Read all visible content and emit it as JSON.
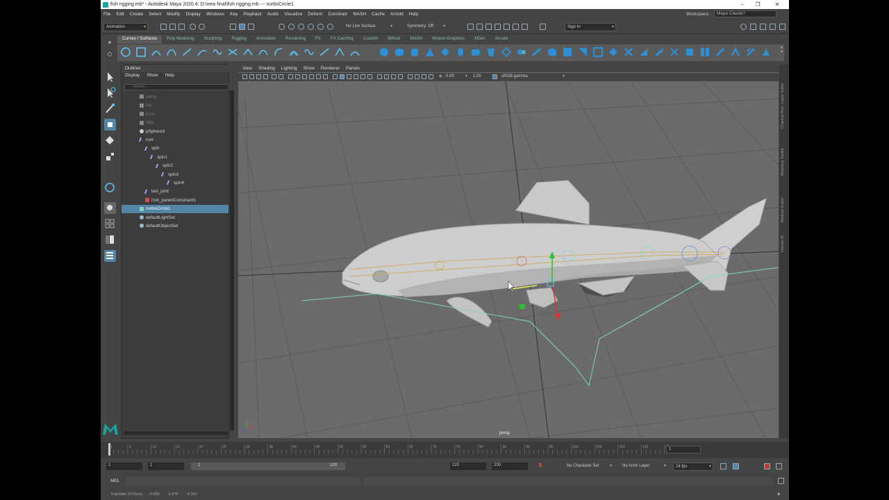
{
  "window": {
    "title": "fish rigging.mb* - Autodesk Maya 2020.4: D:\\new final\\fish rigging.mb  ---  nurbsCircle1",
    "controls": [
      "–",
      "❐",
      "✕"
    ]
  },
  "menubar": {
    "items": [
      "File",
      "Edit",
      "Create",
      "Select",
      "Modify",
      "Display",
      "Windows",
      "Key",
      "Playback",
      "Audio",
      "Visualize",
      "Deform",
      "Constrain",
      "MASH",
      "Cache",
      "Arnold",
      "Help"
    ]
  },
  "workspace": {
    "label": "Workspace :",
    "value": "Maya Classic*"
  },
  "statusline": {
    "menuset": "Animation",
    "live_surface": "No Live Surface",
    "symmetry": "Symmetry: Off",
    "signin": "Sign In"
  },
  "shelf": {
    "tabs": [
      "Curves / Surfaces",
      "Poly Modeling",
      "Sculpting",
      "Rigging",
      "Animation",
      "Rendering",
      "FX",
      "FX Caching",
      "Custom",
      "Bifrost",
      "MASH",
      "Motion Graphics",
      "XGen",
      "Arnold"
    ],
    "active_tab": "Curves / Surfaces"
  },
  "outliner": {
    "title": "Outliner",
    "menu": [
      "Display",
      "Show",
      "Help"
    ],
    "search_placeholder": "Search...",
    "items": [
      {
        "label": "persp",
        "indent": 0,
        "type": "camera",
        "dim": true
      },
      {
        "label": "top",
        "indent": 0,
        "type": "camera",
        "dim": true
      },
      {
        "label": "front",
        "indent": 0,
        "type": "camera",
        "dim": true
      },
      {
        "label": "side",
        "indent": 0,
        "type": "camera",
        "dim": true
      },
      {
        "label": "pSphere3",
        "indent": 0,
        "type": "mesh",
        "dim": false
      },
      {
        "label": "root",
        "indent": 0,
        "type": "joint",
        "dim": false
      },
      {
        "label": "spin",
        "indent": 1,
        "type": "joint",
        "dim": false
      },
      {
        "label": "spin1",
        "indent": 2,
        "type": "joint",
        "dim": false
      },
      {
        "label": "spin2",
        "indent": 3,
        "type": "joint",
        "dim": false
      },
      {
        "label": "spin3",
        "indent": 4,
        "type": "joint",
        "dim": false
      },
      {
        "label": "spin4",
        "indent": 5,
        "type": "joint",
        "dim": false
      },
      {
        "label": "last_joint",
        "indent": 1,
        "type": "joint",
        "dim": false
      },
      {
        "label": "root_parentConstraint1",
        "indent": 1,
        "type": "constraint",
        "dim": false
      },
      {
        "label": "nurbsCircle1",
        "indent": 0,
        "type": "curve",
        "dim": false,
        "selected": true
      },
      {
        "label": "defaultLightSet",
        "indent": 0,
        "type": "set",
        "dim": false
      },
      {
        "label": "defaultObjectSet",
        "indent": 0,
        "type": "set",
        "dim": false
      }
    ]
  },
  "viewport": {
    "menu": [
      "View",
      "Shading",
      "Lighting",
      "Show",
      "Renderer",
      "Panels"
    ],
    "exposure": "0.00",
    "gamma": "1.00",
    "colorspace": "sRGB gamma",
    "camera_label": "persp"
  },
  "right_tabs": [
    "Channel Box / Layer Editor",
    "Modeling Toolkit",
    "Attribute Editor",
    "Human IK"
  ],
  "timeslider": {
    "ticks": [
      "1",
      "5",
      "10",
      "15",
      "20",
      "25",
      "30",
      "35",
      "40",
      "45",
      "50",
      "55",
      "60",
      "65",
      "70",
      "75",
      "80",
      "85",
      "90",
      "95",
      "100",
      "105",
      "110",
      "115",
      "120"
    ],
    "current_frame": "1"
  },
  "rangeslider": {
    "start": "1",
    "anim_start": "1",
    "range_in": "1",
    "range_out": "120",
    "end": "120",
    "anim_end": "200",
    "character_set": "No Character Set",
    "anim_layer": "No Anim Layer",
    "fps": "24 fps"
  },
  "cmdline": {
    "label": "MEL"
  },
  "helpline": {
    "label": "Translate XYZ(cm):",
    "x": "-0.059",
    "y": "-0.576",
    "z": "-0.347"
  },
  "colors": {
    "selection": "#5285a6",
    "joint": "#d4a03c",
    "curve": "#7fd6c0",
    "axis_x": "#e03030",
    "axis_y": "#30c030",
    "axis_z": "#3070ff"
  }
}
